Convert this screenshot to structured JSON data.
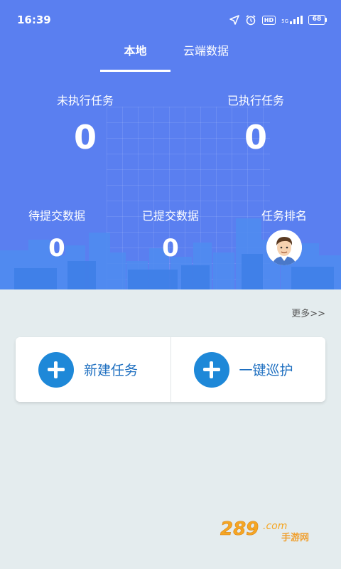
{
  "status_bar": {
    "time": "16:39",
    "network_label": "5G",
    "hd_label": "HD",
    "battery": "68",
    "icons": [
      "location-icon",
      "alarm-icon",
      "hd-icon",
      "signal-icon",
      "battery-icon"
    ]
  },
  "tabs": [
    {
      "label": "本地",
      "active": true
    },
    {
      "label": "云端数据",
      "active": false
    }
  ],
  "stats_top": [
    {
      "label": "未执行任务",
      "value": "0"
    },
    {
      "label": "已执行任务",
      "value": "0"
    }
  ],
  "stats_bottom": [
    {
      "label": "待提交数据",
      "value": "0"
    },
    {
      "label": "已提交数据",
      "value": "0"
    },
    {
      "label": "任务排名"
    }
  ],
  "more_link": "更多>>",
  "actions": [
    {
      "label": "新建任务",
      "icon": "plus-icon"
    },
    {
      "label": "一键巡护",
      "icon": "plus-icon"
    }
  ],
  "watermark": {
    "text": "289.com 手游网"
  },
  "colors": {
    "header_bg": "#5a7ff0",
    "page_bg": "#e4ecee",
    "action_icon": "#1e88d8",
    "action_text": "#1e6fc0"
  }
}
